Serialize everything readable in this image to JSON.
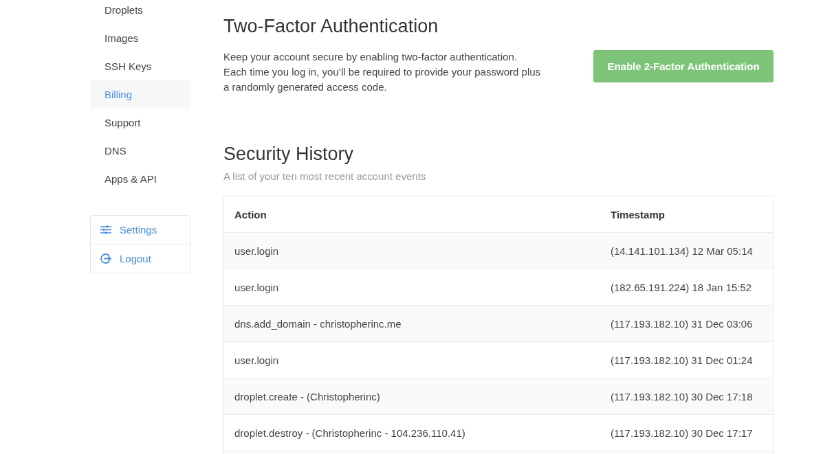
{
  "sidebar": {
    "items": [
      {
        "label": "Droplets",
        "selected": false
      },
      {
        "label": "Images",
        "selected": false
      },
      {
        "label": "SSH Keys",
        "selected": false
      },
      {
        "label": "Billing",
        "selected": true
      },
      {
        "label": "Support",
        "selected": false
      },
      {
        "label": "DNS",
        "selected": false
      },
      {
        "label": "Apps & API",
        "selected": false
      }
    ],
    "account_menu": [
      {
        "kind": "settings",
        "label": "Settings"
      },
      {
        "kind": "logout",
        "label": "Logout"
      }
    ]
  },
  "two_factor": {
    "title": "Two-Factor Authentication",
    "description": [
      "Keep your account secure by enabling two-factor authentication.",
      "Each time you log in, you’ll be required to provide your password plus a randomly generated access code."
    ],
    "button": "Enable 2-Factor Authentication"
  },
  "security_history": {
    "title": "Security History",
    "subtitle": "A list of your ten most recent account events",
    "table": {
      "columns": [
        "Action",
        "Timestamp"
      ],
      "rows": [
        [
          "user.login",
          "(14.141.101.134) 12 Mar 05:14"
        ],
        [
          "user.login",
          "(182.65.191.224) 18 Jan 15:52"
        ],
        [
          "dns.add_domain - christopherinc.me",
          "(117.193.182.10) 31 Dec 03:06"
        ],
        [
          "user.login",
          "(117.193.182.10) 31 Dec 01:24"
        ],
        [
          "droplet.create - (Christopherinc)",
          "(117.193.182.10) 30 Dec 17:18"
        ],
        [
          "droplet.destroy - (Christopherinc - 104.236.110.41)",
          "(117.193.182.10) 30 Dec 17:17"
        ]
      ]
    }
  }
}
